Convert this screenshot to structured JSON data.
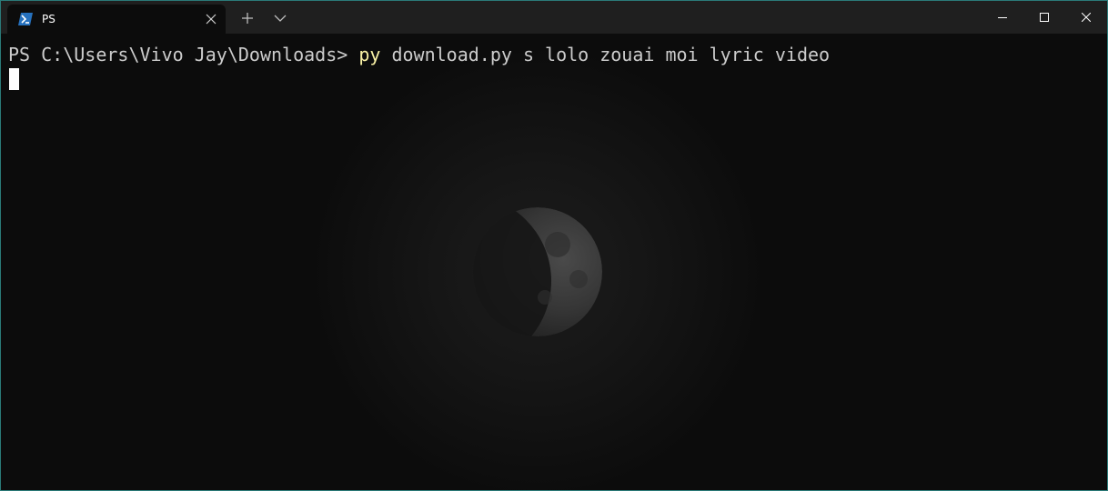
{
  "tab": {
    "title": "PS",
    "icon": "powershell-icon",
    "close_icon": "close-icon"
  },
  "titlebar": {
    "new_tab_icon": "plus-icon",
    "dropdown_icon": "chevron-down-icon",
    "minimize_icon": "minimize-icon",
    "maximize_icon": "maximize-icon",
    "close_icon": "close-icon"
  },
  "terminal": {
    "prompt": "PS C:\\Users\\Vivo Jay\\Downloads> ",
    "command": "py",
    "arguments": " download.py s lolo zouai moi lyric video",
    "background_image": "moon-icon"
  },
  "colors": {
    "titlebar": "#1f1f1f",
    "terminal_bg": "#0c0c0c",
    "text": "#cccccc",
    "command": "#f9f1a5",
    "border": "#2b7a78"
  }
}
